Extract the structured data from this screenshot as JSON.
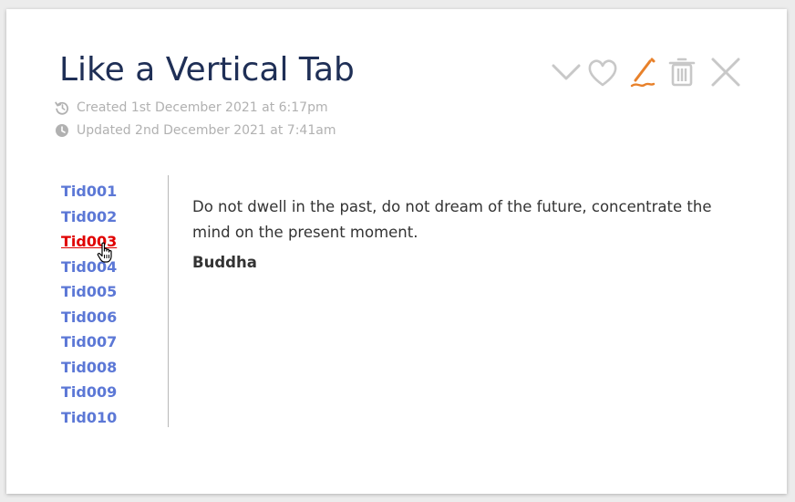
{
  "tiddler": {
    "title": "Like a Vertical Tab",
    "created": "Created 1st December 2021 at 6:17pm",
    "updated": "Updated 2nd December 2021 at 7:41am"
  },
  "toolbar": {
    "icons": [
      "chevron-down-icon",
      "heart-icon",
      "pencil-icon",
      "trash-icon",
      "close-icon"
    ],
    "icon_color": "#c8c8c8",
    "edit_color": "#e8812a"
  },
  "tabs": [
    {
      "label": "Tid001"
    },
    {
      "label": "Tid002"
    },
    {
      "label": "Tid003"
    },
    {
      "label": "Tid004"
    },
    {
      "label": "Tid005"
    },
    {
      "label": "Tid006"
    },
    {
      "label": "Tid007"
    },
    {
      "label": "Tid008"
    },
    {
      "label": "Tid009"
    },
    {
      "label": "Tid010"
    }
  ],
  "hovered_tab": "Tid003",
  "content": {
    "quote": "Do not dwell in the past, do not dream of the future, concentrate the mind on the present moment.",
    "author": "Buddha"
  },
  "colors": {
    "title": "#1f2f56",
    "link": "#5c78d6",
    "link_hover": "#e00000",
    "meta": "#b1b1b1"
  }
}
